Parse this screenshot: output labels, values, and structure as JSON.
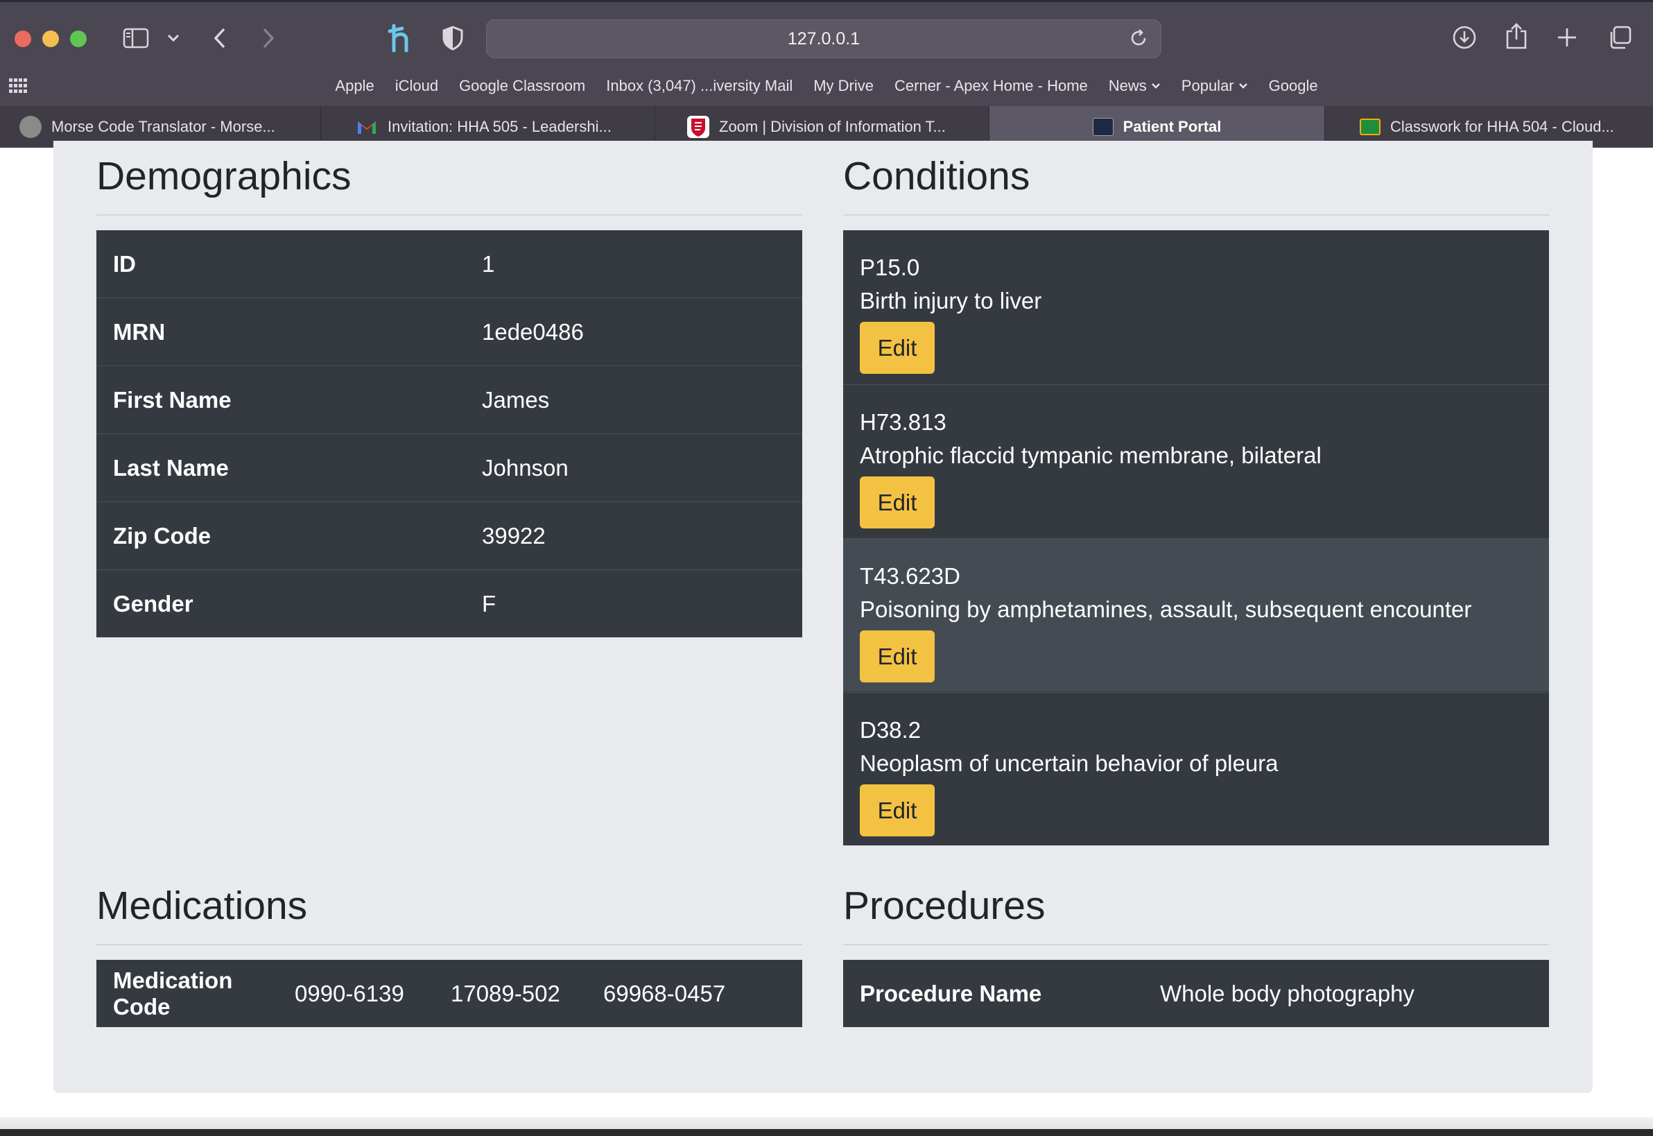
{
  "browser": {
    "url": "127.0.0.1",
    "bookmarks": [
      "Apple",
      "iCloud",
      "Google Classroom",
      "Inbox (3,047) ...iversity Mail",
      "My Drive",
      "Cerner - Apex Home - Home",
      "News",
      "Popular",
      "Google"
    ],
    "tabs": [
      {
        "title": "Morse Code Translator - Morse...",
        "icon": "morse-favicon",
        "active": false
      },
      {
        "title": "Invitation: HHA 505 - Leadershi...",
        "icon": "gmail-favicon",
        "active": false
      },
      {
        "title": "Zoom | Division of Information T...",
        "icon": "university-favicon",
        "active": false
      },
      {
        "title": "Patient Portal",
        "icon": "terminal-favicon",
        "active": true
      },
      {
        "title": "Classwork for HHA 504 - Cloud...",
        "icon": "classroom-favicon",
        "active": false
      }
    ]
  },
  "demographics": {
    "title": "Demographics",
    "rows": [
      {
        "label": "ID",
        "value": "1"
      },
      {
        "label": "MRN",
        "value": "1ede0486"
      },
      {
        "label": "First Name",
        "value": "James"
      },
      {
        "label": "Last Name",
        "value": "Johnson"
      },
      {
        "label": "Zip Code",
        "value": "39922"
      },
      {
        "label": "Gender",
        "value": "F"
      }
    ]
  },
  "conditions": {
    "title": "Conditions",
    "edit_label": "Edit",
    "items": [
      {
        "code": "P15.0",
        "description": "Birth injury to liver"
      },
      {
        "code": "H73.813",
        "description": "Atrophic flaccid tympanic membrane, bilateral"
      },
      {
        "code": "T43.623D",
        "description": "Poisoning by amphetamines, assault, subsequent encounter"
      },
      {
        "code": "D38.2",
        "description": "Neoplasm of uncertain behavior of pleura"
      }
    ]
  },
  "medications": {
    "title": "Medications",
    "label": "Medication Code",
    "codes": [
      "0990-6139",
      "17089-502",
      "69968-0457"
    ]
  },
  "procedures": {
    "title": "Procedures",
    "label": "Procedure Name",
    "value": "Whole body photography"
  },
  "colors": {
    "table_bg": "#343a40",
    "edit_button": "#f4c242",
    "page_panel": "#e9eaee"
  }
}
